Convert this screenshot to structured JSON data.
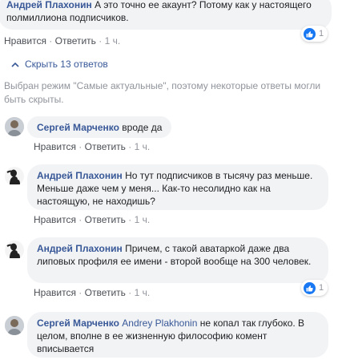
{
  "top_comment": {
    "author": "Андрей Плахонин",
    "text": " А это точно ее акаунт? Потому как у настоящего полмиллиона подписчиков.",
    "like": "Нравится",
    "reply": "Ответить",
    "time": "1 ч.",
    "reaction_count": "1"
  },
  "replies_toggle": "Скрыть 13 ответов",
  "notice": "Выбран режим \"Самые актуальные\", поэтому некоторые ответы могли быть скрыты.",
  "replies": [
    {
      "author": "Сергей Марченко",
      "text": " вроде да",
      "like": "Нравится",
      "reply": "Ответить",
      "time": "1 ч."
    },
    {
      "author": "Андрей Плахонин",
      "text": " Но тут подписчиков в тысячу раз меньше. Меньше даже чем у меня... Как-то несолидно как на настоящую, не находишь?",
      "like": "Нравится",
      "reply": "Ответить",
      "time": "1 ч."
    },
    {
      "author": "Андрей Плахонин",
      "text": " Причем, с такой аватаркой даже два липовых профиля ее имени - второй вообще на 300 человек.",
      "like": "Нравится",
      "reply": "Ответить",
      "time": "1 ч.",
      "reaction_count": "1"
    },
    {
      "author": "Сергей Марченко",
      "mention": " Andrey Plakhonin",
      "text": " не копал так глубоко. В целом, вполне в ее жизненную философию комент вписывается"
    }
  ],
  "icons": {
    "like": "like-icon",
    "chevron": "chevron-up-icon"
  },
  "colors": {
    "link": "#385898",
    "like_blue": "#1877f2",
    "bubble": "#f2f3f5",
    "meta": "#90949c"
  }
}
